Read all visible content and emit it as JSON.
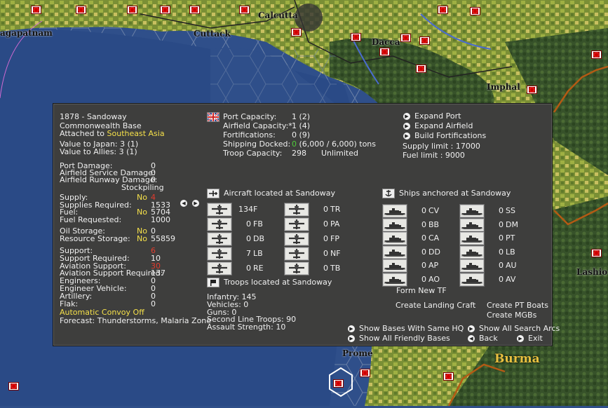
{
  "map": {
    "labels": [
      "agapatnam",
      "Cuttack",
      "Calcutta",
      "Dacca",
      "Imphal",
      "Prome",
      "Burma",
      "Lashio"
    ],
    "colors": {
      "ocean": "#2f4f8a",
      "land": "#6f8f3a",
      "jungle": "#3d5a2a",
      "grid": "#7888a8"
    }
  },
  "panel": {
    "base": {
      "title": "1878 - Sandoway",
      "type": "Commonwealth Base",
      "attached_prefix": "Attached to ",
      "attached_value": "Southeast Asia",
      "value_japan": "Value to Japan:  3 (1)",
      "value_allies": "Value to Allies:  3 (1)"
    },
    "damage": [
      {
        "label": "Port Damage:",
        "value": "0"
      },
      {
        "label": "Airfield Service Damage:",
        "value": "0"
      },
      {
        "label": "Airfield Runway Damage:",
        "value": "0"
      }
    ],
    "stockpiling": "Stockpiling",
    "supply": [
      {
        "label": "Supply:",
        "flag": "No",
        "value": "4",
        "value_color": "red"
      },
      {
        "label": "Supplies Required:",
        "flag": "",
        "value": "1533",
        "value_color": "white"
      },
      {
        "label": "Fuel:",
        "flag": "No",
        "value": "5704",
        "value_color": "white"
      },
      {
        "label": "Fuel Requested:",
        "flag": "",
        "value": "1000",
        "value_color": "white"
      }
    ],
    "storage": [
      {
        "label": "Oil Storage:",
        "flag": "No",
        "value": "0"
      },
      {
        "label": "Resource Storage:",
        "flag": "No",
        "value": "55859"
      }
    ],
    "support": [
      {
        "label": "Support:",
        "value": "6",
        "value_color": "red"
      },
      {
        "label": "Support Required:",
        "value": "10",
        "value_color": "white"
      },
      {
        "label": "Aviation Support:",
        "value": "30",
        "value_color": "red"
      },
      {
        "label": "Aviation Support Required:",
        "value": "137",
        "value_color": "white"
      },
      {
        "label": "Engineers:",
        "value": "0",
        "value_color": "white"
      },
      {
        "label": "Engineer Vehicle:",
        "value": "0",
        "value_color": "white"
      },
      {
        "label": "Artillery:",
        "value": "0",
        "value_color": "white"
      },
      {
        "label": "Flak:",
        "value": "0",
        "value_color": "white"
      }
    ],
    "convoy": "Automatic Convoy Off",
    "forecast": "Forecast: Thunderstorms, Malaria Zone",
    "capacity": [
      {
        "label": "Port Capacity:",
        "value": "1 (2)",
        "extra": ""
      },
      {
        "label": "Airfield Capacity:*",
        "value": "1 (4)",
        "extra": ""
      },
      {
        "label": "Fortifications:",
        "value": "0 (9)",
        "extra": ""
      },
      {
        "label": "Shipping Docked:",
        "value": "0",
        "extra": " (6,000 / 6,000) tons"
      },
      {
        "label": "Troop Capacity:",
        "value": "298",
        "extra": "Unlimited"
      }
    ],
    "expand": {
      "port": "Expand Port",
      "airfield": "Expand Airfield",
      "forts": "Build Fortifications",
      "supply_limit": "Supply limit : 17000",
      "fuel_limit": "Fuel limit : 9000"
    },
    "aircraft": {
      "header": "Aircraft located at Sandoway",
      "left": [
        {
          "count": "134",
          "type": "F"
        },
        {
          "count": "0",
          "type": "FB"
        },
        {
          "count": "0",
          "type": "DB"
        },
        {
          "count": "7",
          "type": "LB"
        },
        {
          "count": "0",
          "type": "RE"
        }
      ],
      "right": [
        {
          "count": "0",
          "type": "TR"
        },
        {
          "count": "0",
          "type": "PA"
        },
        {
          "count": "0",
          "type": "FP"
        },
        {
          "count": "0",
          "type": "NF"
        },
        {
          "count": "0",
          "type": "TB"
        }
      ]
    },
    "troops": {
      "header": "Troops located at Sandoway",
      "lines": [
        "Infantry: 145",
        "Vehicles: 0",
        "Guns: 0",
        "Second Line Troops: 90",
        "Assault Strength: 10"
      ]
    },
    "ships": {
      "header": "Ships anchored at Sandoway",
      "left": [
        {
          "count": "0",
          "type": "CV"
        },
        {
          "count": "0",
          "type": "BB"
        },
        {
          "count": "0",
          "type": "CA"
        },
        {
          "count": "0",
          "type": "DD"
        },
        {
          "count": "0",
          "type": "AP"
        },
        {
          "count": "0",
          "type": "AO"
        }
      ],
      "right": [
        {
          "count": "0",
          "type": "SS"
        },
        {
          "count": "0",
          "type": "DM"
        },
        {
          "count": "0",
          "type": "PT"
        },
        {
          "count": "0",
          "type": "LB"
        },
        {
          "count": "0",
          "type": "AU"
        },
        {
          "count": "0",
          "type": "AV"
        }
      ]
    },
    "actions": {
      "form_tf": "Form New TF",
      "landing_craft": "Create Landing Craft",
      "pt_boats": "Create PT Boats",
      "mgbs": "Create MGBs",
      "same_hq": "Show Bases With Same HQ",
      "search_arcs": "Show All Search Arcs",
      "friendly_bases": "Show All Friendly Bases",
      "back": "Back",
      "exit": "Exit"
    }
  }
}
